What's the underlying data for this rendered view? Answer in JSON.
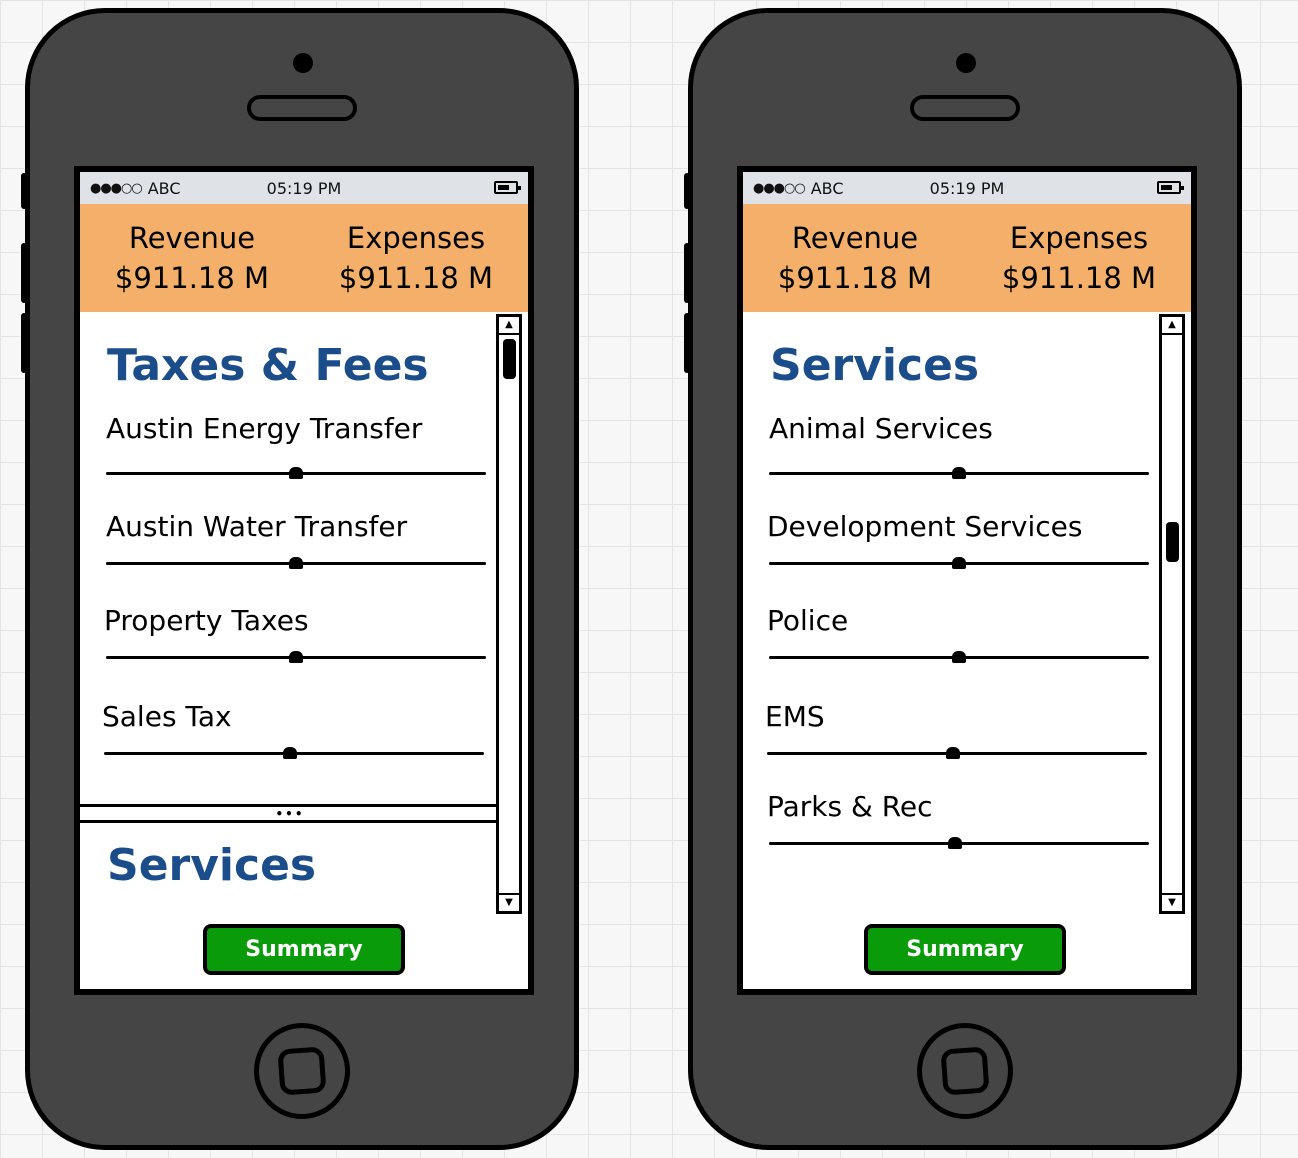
{
  "phones": [
    {
      "status": {
        "signal": "●●●○○",
        "carrier": "ABC",
        "time": "05:19 PM"
      },
      "totals": [
        {
          "label": "Revenue",
          "value": "$911.18 M"
        },
        {
          "label": "Expenses",
          "value": "$911.18 M"
        }
      ],
      "section_title": "Taxes & Fees",
      "items": [
        {
          "label": "Austin Energy Transfer",
          "level": 0.5
        },
        {
          "label": "Austin Water Transfer",
          "level": 0.5
        },
        {
          "label": "Property Taxes",
          "level": 0.5
        },
        {
          "label": "Sales Tax",
          "level": 0.49
        }
      ],
      "next_section_title": "Services",
      "divider": "•••",
      "summary_label": "Summary"
    },
    {
      "status": {
        "signal": "●●●○○",
        "carrier": "ABC",
        "time": "05:19 PM"
      },
      "totals": [
        {
          "label": "Revenue",
          "value": "$911.18 M"
        },
        {
          "label": "Expenses",
          "value": "$911.18 M"
        }
      ],
      "section_title": "Services",
      "items": [
        {
          "label": "Animal Services",
          "level": 0.5
        },
        {
          "label": "Development Services",
          "level": 0.5
        },
        {
          "label": "Police",
          "level": 0.5
        },
        {
          "label": "EMS",
          "level": 0.49
        },
        {
          "label": "Parks & Rec",
          "level": 0.49
        }
      ],
      "summary_label": "Summary"
    }
  ],
  "scrollbar_icons": {
    "up": "arrow-up-icon",
    "down": "arrow-down-icon"
  },
  "colors": {
    "header": "#f4b06a",
    "title": "#1a4d8a",
    "button": "#0a9b0a",
    "device": "#454545"
  }
}
